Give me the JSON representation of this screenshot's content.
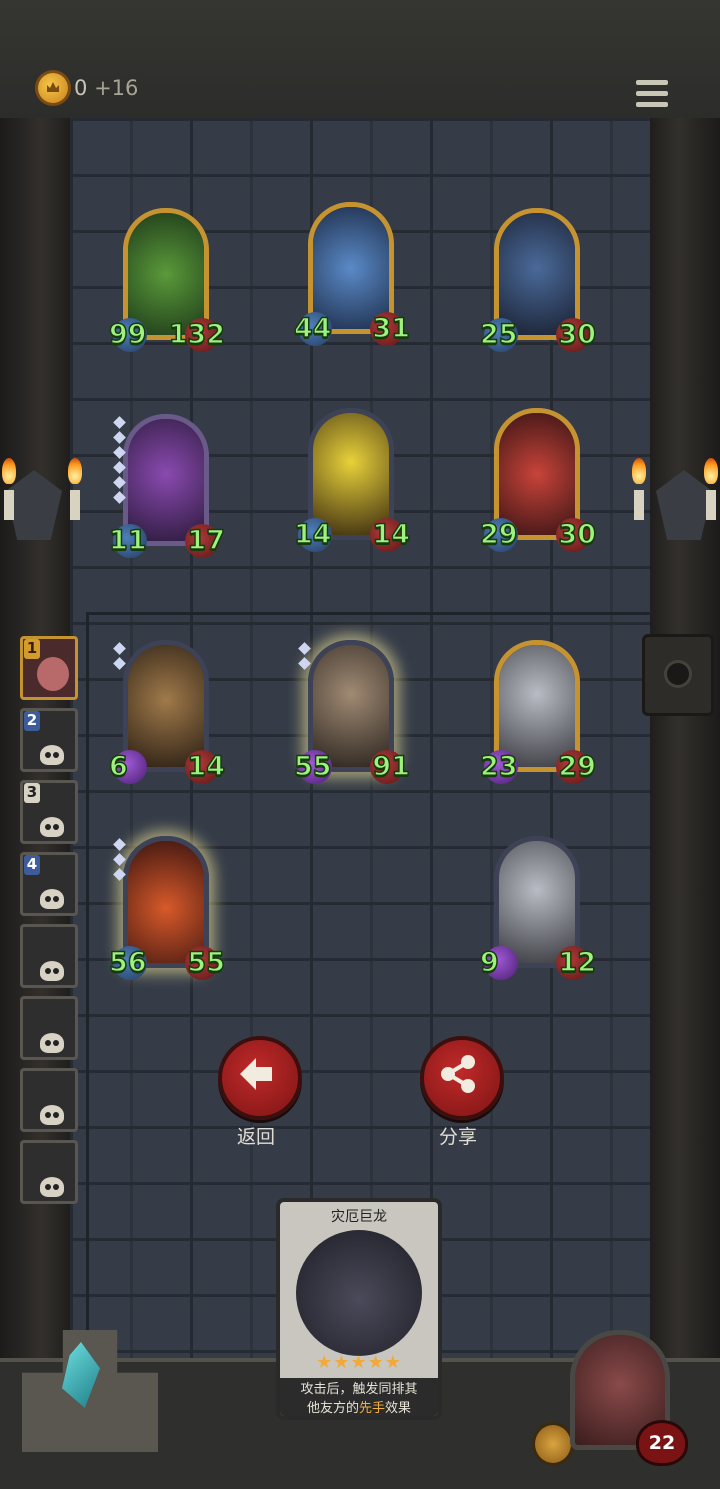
{
  "topbar": {
    "gold_amount": "0",
    "gold_bonus": "+16",
    "coin_icon": "crown-coin-icon",
    "menu_icon": "hamburger-menu-icon"
  },
  "enemy_board": [
    {
      "name": "green-dragon",
      "atk": "99",
      "hp": "132",
      "frame": "gold"
    },
    {
      "name": "blue-dragon",
      "atk": "44",
      "hp": "31",
      "frame": "gold"
    },
    {
      "name": "armored-knight",
      "atk": "25",
      "hp": "30",
      "frame": "gold"
    },
    {
      "name": "doom-dragon",
      "atk": "11",
      "hp": "17",
      "frame": "blue"
    },
    {
      "name": "naga-priest",
      "atk": "14",
      "hp": "14",
      "frame": "blue"
    },
    {
      "name": "red-demon",
      "atk": "29",
      "hp": "30",
      "frame": "gold"
    }
  ],
  "player_board": [
    {
      "name": "adventurer",
      "atk": "6",
      "hp": "14",
      "frame": "blue"
    },
    {
      "name": "brute",
      "atk": "55",
      "hp": "91",
      "frame": "blue-glow"
    },
    {
      "name": "steel-knight",
      "atk": "23",
      "hp": "29",
      "frame": "gold"
    },
    {
      "name": "fire-dragon",
      "atk": "56",
      "hp": "55",
      "frame": "blue-glow"
    },
    {
      "name": "steel-knight-2",
      "atk": "9",
      "hp": "12",
      "frame": "blue"
    }
  ],
  "buttons": {
    "back_label": "返回",
    "share_label": "分享"
  },
  "leaderboard": [
    {
      "rank": "1",
      "active": true
    },
    {
      "rank": "2",
      "active": false
    },
    {
      "rank": "3",
      "active": false
    },
    {
      "rank": "4",
      "active": false
    },
    {
      "rank": "",
      "active": false
    },
    {
      "rank": "",
      "active": false
    },
    {
      "rank": "",
      "active": false
    },
    {
      "rank": "",
      "active": false
    }
  ],
  "info_card": {
    "title": "灾厄巨龙",
    "stars": "★★★★★",
    "desc_part1": "攻击后，触发同排其",
    "desc_part2": "他友方的",
    "desc_highlight": "先手",
    "desc_part3": "效果"
  },
  "hero": {
    "health": "22"
  },
  "colors": {
    "stat_green": "#9ef27e",
    "button_red": "#c12a2a",
    "gold_frame": "#c69331",
    "highlight": "#f2b03a"
  }
}
